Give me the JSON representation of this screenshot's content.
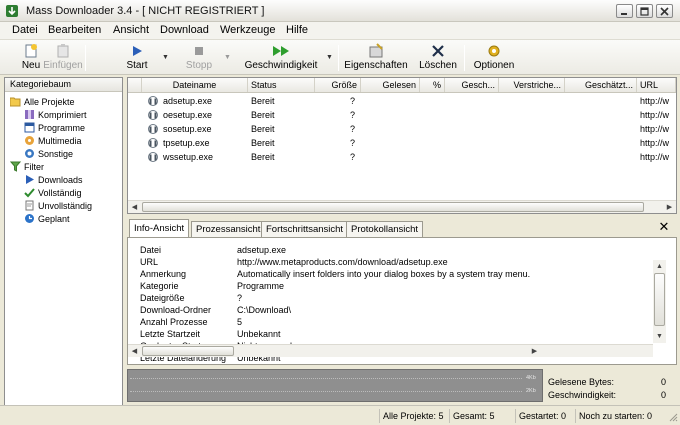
{
  "window": {
    "title": "Mass Downloader 3.4  - [ NICHT REGISTRIERT ]"
  },
  "menu": [
    "Datei",
    "Bearbeiten",
    "Ansicht",
    "Download",
    "Werkzeuge",
    "Hilfe"
  ],
  "toolbar": {
    "new": "Neu",
    "paste": "Einfügen",
    "start": "Start",
    "stop": "Stopp",
    "speed": "Geschwindigkeit",
    "properties": "Eigenschaften",
    "delete": "Löschen",
    "options": "Optionen"
  },
  "left_panel": {
    "header": "Kategoriebaum",
    "items": [
      {
        "label": "Alle Projekte",
        "icon": "folder-open-icon",
        "level": 0
      },
      {
        "label": "Komprimiert",
        "icon": "compressed-icon",
        "level": 1
      },
      {
        "label": "Programme",
        "icon": "program-icon",
        "level": 1
      },
      {
        "label": "Multimedia",
        "icon": "multimedia-icon",
        "level": 1
      },
      {
        "label": "Sonstige",
        "icon": "misc-icon",
        "level": 1
      },
      {
        "label": "Filter",
        "icon": "filter-icon",
        "level": 0
      },
      {
        "label": "Downloads",
        "icon": "downloads-icon",
        "level": 1
      },
      {
        "label": "Vollständig",
        "icon": "complete-check-icon",
        "level": 1
      },
      {
        "label": "Unvollständig",
        "icon": "incomplete-icon",
        "level": 1
      },
      {
        "label": "Geplant",
        "icon": "scheduled-icon",
        "level": 1
      }
    ]
  },
  "file_table": {
    "columns": [
      "Dateiname",
      "Status",
      "Größe",
      "Gelesen",
      "%",
      "Gesch...",
      "Verstriche...",
      "Geschätzt...",
      "URL"
    ],
    "rows": [
      {
        "name": "adsetup.exe",
        "status": "Bereit",
        "size": "?",
        "url": "http://w"
      },
      {
        "name": "oesetup.exe",
        "status": "Bereit",
        "size": "?",
        "url": "http://w"
      },
      {
        "name": "sosetup.exe",
        "status": "Bereit",
        "size": "?",
        "url": "http://w"
      },
      {
        "name": "tpsetup.exe",
        "status": "Bereit",
        "size": "?",
        "url": "http://w"
      },
      {
        "name": "wssetup.exe",
        "status": "Bereit",
        "size": "?",
        "url": "http://w"
      }
    ]
  },
  "tabs": [
    "Info-Ansicht",
    "Prozessansicht",
    "Fortschrittsansicht",
    "Protokollansicht"
  ],
  "info": [
    {
      "key": "Datei",
      "value": "adsetup.exe"
    },
    {
      "key": "URL",
      "value": "http://www.metaproducts.com/download/adsetup.exe"
    },
    {
      "key": "Anmerkung",
      "value": "Automatically insert  folders into your dialog boxes by a system tray menu."
    },
    {
      "key": "Kategorie",
      "value": "Programme"
    },
    {
      "key": "Dateigröße",
      "value": "?"
    },
    {
      "key": "Download-Ordner",
      "value": "C:\\Download\\"
    },
    {
      "key": "Anzahl Prozesse",
      "value": "5"
    },
    {
      "key": "Letzte Startzeit",
      "value": "Unbekannt"
    },
    {
      "key": "Geplanter Start",
      "value": "Nicht angegeben"
    },
    {
      "key": "Letzte Dateiänderung",
      "value": "Unbekannt"
    }
  ],
  "graph": {
    "labels": [
      "4Kb",
      "2Kb"
    ]
  },
  "stats": {
    "read_label": "Gelesene Bytes:",
    "read_value": "0",
    "speed_label": "Geschwindigkeit:",
    "speed_value": "0"
  },
  "status_bar": {
    "all_projects": "Alle Projekte: 5",
    "total": "Gesamt: 5",
    "started": "Gestartet: 0",
    "to_start": "Noch zu starten: 0"
  }
}
